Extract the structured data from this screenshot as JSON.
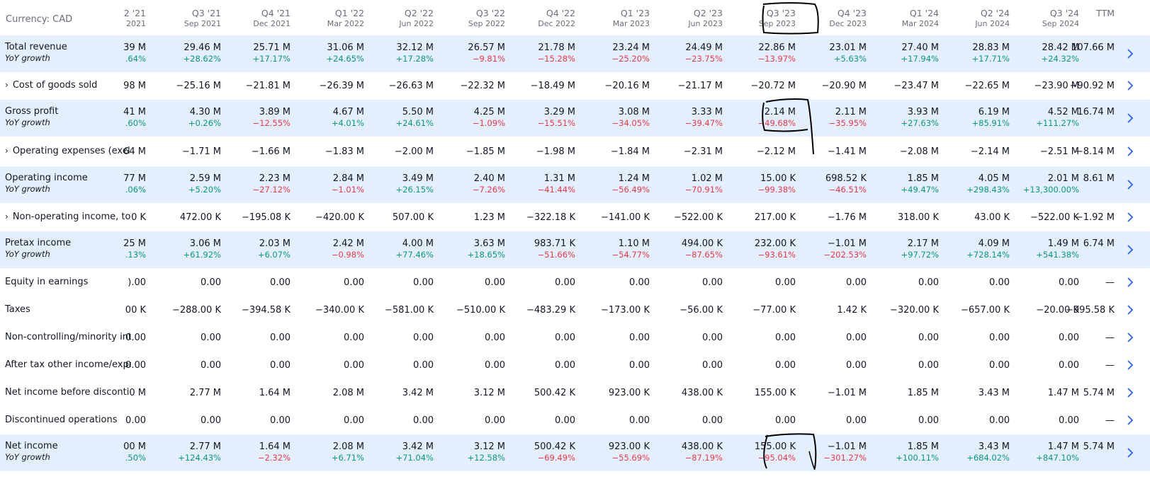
{
  "currency_label": "Currency: CAD",
  "columns": [
    {
      "q": "2 '21",
      "d": "2021"
    },
    {
      "q": "Q3 '21",
      "d": "Sep 2021"
    },
    {
      "q": "Q4 '21",
      "d": "Dec 2021"
    },
    {
      "q": "Q1 '22",
      "d": "Mar 2022"
    },
    {
      "q": "Q2 '22",
      "d": "Jun 2022"
    },
    {
      "q": "Q3 '22",
      "d": "Sep 2022"
    },
    {
      "q": "Q4 '22",
      "d": "Dec 2022"
    },
    {
      "q": "Q1 '23",
      "d": "Mar 2023"
    },
    {
      "q": "Q2 '23",
      "d": "Jun 2023"
    },
    {
      "q": "Q3 '23",
      "d": "Sep 2023"
    },
    {
      "q": "Q4 '23",
      "d": "Dec 2023"
    },
    {
      "q": "Q1 '24",
      "d": "Mar 2024"
    },
    {
      "q": "Q2 '24",
      "d": "Jun 2024"
    },
    {
      "q": "Q3 '24",
      "d": "Sep 2024"
    },
    {
      "q": "TTM",
      "d": ""
    }
  ],
  "rows": [
    {
      "label": "Total revenue",
      "sub": "YoY growth",
      "expandable": false,
      "shaded": true,
      "values": [
        "39 M",
        "29.46 M",
        "25.71 M",
        "31.06 M",
        "32.12 M",
        "26.57 M",
        "21.78 M",
        "23.24 M",
        "24.49 M",
        "22.86 M",
        "23.01 M",
        "27.40 M",
        "28.83 M",
        "28.42 M",
        "107.66 M"
      ],
      "growth": [
        ".64%",
        "+28.62%",
        "+17.17%",
        "+24.65%",
        "+17.28%",
        "−9.81%",
        "−15.28%",
        "−25.20%",
        "−23.75%",
        "−13.97%",
        "+5.63%",
        "+17.94%",
        "+17.71%",
        "+24.32%",
        ""
      ]
    },
    {
      "label": "Cost of goods sold",
      "expandable": true,
      "shaded": false,
      "values": [
        "98 M",
        "−25.16 M",
        "−21.81 M",
        "−26.39 M",
        "−26.63 M",
        "−22.32 M",
        "−18.49 M",
        "−20.16 M",
        "−21.17 M",
        "−20.72 M",
        "−20.90 M",
        "−23.47 M",
        "−22.65 M",
        "−23.90 M",
        "−90.92 M"
      ]
    },
    {
      "label": "Gross profit",
      "sub": "YoY growth",
      "expandable": false,
      "shaded": true,
      "values": [
        "41 M",
        "4.30 M",
        "3.89 M",
        "4.67 M",
        "5.50 M",
        "4.25 M",
        "3.29 M",
        "3.08 M",
        "3.33 M",
        "2.14 M",
        "2.11 M",
        "3.93 M",
        "6.19 M",
        "4.52 M",
        "16.74 M"
      ],
      "growth": [
        ".60%",
        "+0.26%",
        "−12.55%",
        "+4.01%",
        "+24.61%",
        "−1.09%",
        "−15.51%",
        "−34.05%",
        "−39.47%",
        "−49.68%",
        "−35.95%",
        "+27.63%",
        "+85.91%",
        "+111.27%",
        ""
      ]
    },
    {
      "label": "Operating expenses (excl.",
      "expandable": true,
      "shaded": false,
      "values": "64 M|−1.71 M|−1.66 M|−1.83 M|−2.00 M|−1.85 M|−1.98 M|−1.84 M|−2.31 M|−2.12 M|−1.41 M|−2.08 M|−2.14 M|−2.51 M|−8.14 M"
    },
    {
      "label": "Operating income",
      "sub": "YoY growth",
      "expandable": false,
      "shaded": true,
      "values": [
        "77 M",
        "2.59 M",
        "2.23 M",
        "2.84 M",
        "3.49 M",
        "2.40 M",
        "1.31 M",
        "1.24 M",
        "1.02 M",
        "15.00 K",
        "698.52 K",
        "1.85 M",
        "4.05 M",
        "2.01 M",
        "8.61 M"
      ],
      "growth": [
        ".06%",
        "+5.20%",
        "−27.12%",
        "−1.01%",
        "+26.15%",
        "−7.26%",
        "−41.44%",
        "−56.49%",
        "−70.91%",
        "−99.38%",
        "−46.51%",
        "+49.47%",
        "+298.43%",
        "+13,300.00%",
        ""
      ]
    },
    {
      "label": "Non-operating income, tot",
      "expandable": true,
      "shaded": false,
      "values": [
        "0 K",
        "472.00 K",
        "−195.08 K",
        "−420.00 K",
        "507.00 K",
        "1.23 M",
        "−322.18 K",
        "−141.00 K",
        "−522.00 K",
        "217.00 K",
        "−1.76 M",
        "318.00 K",
        "43.00 K",
        "−522.00 K",
        "−1.92 M"
      ]
    },
    {
      "label": "Pretax income",
      "sub": "YoY growth",
      "expandable": false,
      "shaded": true,
      "values": [
        "25 M",
        "3.06 M",
        "2.03 M",
        "2.42 M",
        "4.00 M",
        "3.63 M",
        "983.71 K",
        "1.10 M",
        "494.00 K",
        "232.00 K",
        "−1.01 M",
        "2.17 M",
        "4.09 M",
        "1.49 M",
        "6.74 M"
      ],
      "growth": [
        ".13%",
        "+61.92%",
        "+6.07%",
        "−0.98%",
        "+77.46%",
        "+18.65%",
        "−51.66%",
        "−54.77%",
        "−87.65%",
        "−93.61%",
        "−202.53%",
        "+97.72%",
        "+728.14%",
        "+541.38%",
        ""
      ]
    },
    {
      "label": "Equity in earnings",
      "expandable": false,
      "shaded": false,
      "values": [
        ").00",
        "0.00",
        "0.00",
        "0.00",
        "0.00",
        "0.00",
        "0.00",
        "0.00",
        "0.00",
        "0.00",
        "0.00",
        "0.00",
        "0.00",
        "0.00",
        "—"
      ]
    },
    {
      "label": "Taxes",
      "expandable": false,
      "shaded": false,
      "values": [
        "00 K",
        "−288.00 K",
        "−394.58 K",
        "−340.00 K",
        "−581.00 K",
        "−510.00 K",
        "−483.29 K",
        "−173.00 K",
        "−56.00 K",
        "−77.00 K",
        "1.42 K",
        "−320.00 K",
        "−657.00 K",
        "−20.00 K",
        "−995.58 K"
      ]
    },
    {
      "label": "Non-controlling/minority int",
      "expandable": false,
      "shaded": false,
      "values": [
        "0.00",
        "0.00",
        "0.00",
        "0.00",
        "0.00",
        "0.00",
        "0.00",
        "0.00",
        "0.00",
        "0.00",
        "0.00",
        "0.00",
        "0.00",
        "0.00",
        "—"
      ]
    },
    {
      "label": "After tax other income/expe",
      "expandable": false,
      "shaded": false,
      "values": [
        "0.00",
        "0.00",
        "0.00",
        "0.00",
        "0.00",
        "0.00",
        "0.00",
        "0.00",
        "0.00",
        "0.00",
        "0.00",
        "0.00",
        "0.00",
        "0.00",
        "—"
      ]
    },
    {
      "label": "Net income before disconti",
      "expandable": false,
      "shaded": false,
      "values": [
        "0 M",
        "2.77 M",
        "1.64 M",
        "2.08 M",
        "3.42 M",
        "3.12 M",
        "500.42 K",
        "923.00 K",
        "438.00 K",
        "155.00 K",
        "−1.01 M",
        "1.85 M",
        "3.43 M",
        "1.47 M",
        "5.74 M"
      ]
    },
    {
      "label": "Discontinued operations",
      "expandable": false,
      "shaded": false,
      "values": [
        "0.00",
        "0.00",
        "0.00",
        "0.00",
        "0.00",
        "0.00",
        "0.00",
        "0.00",
        "0.00",
        "0.00",
        "0.00",
        "0.00",
        "0.00",
        "0.00",
        "—"
      ]
    },
    {
      "label": "Net income",
      "sub": "YoY growth",
      "expandable": false,
      "shaded": true,
      "values": [
        "00 M",
        "2.77 M",
        "1.64 M",
        "2.08 M",
        "3.42 M",
        "3.12 M",
        "500.42 K",
        "923.00 K",
        "438.00 K",
        "155.00 K",
        "−1.01 M",
        "1.85 M",
        "3.43 M",
        "1.47 M",
        "5.74 M"
      ],
      "growth": [
        ".50%",
        "+124.43%",
        "−2.32%",
        "+6.71%",
        "+71.04%",
        "+12.58%",
        "−69.49%",
        "−55.69%",
        "−87.19%",
        "−95.04%",
        "−301.27%",
        "+100.11%",
        "+684.02%",
        "+847.10%",
        ""
      ]
    }
  ],
  "colors": {
    "shade": "#e3effd",
    "positive": "#089981",
    "negative": "#f23645",
    "arrow": "#2962ff",
    "muted": "#6a6d78"
  },
  "icons": {
    "row_action": "chevron-right-icon",
    "expand": "chevron-right-small-icon"
  }
}
